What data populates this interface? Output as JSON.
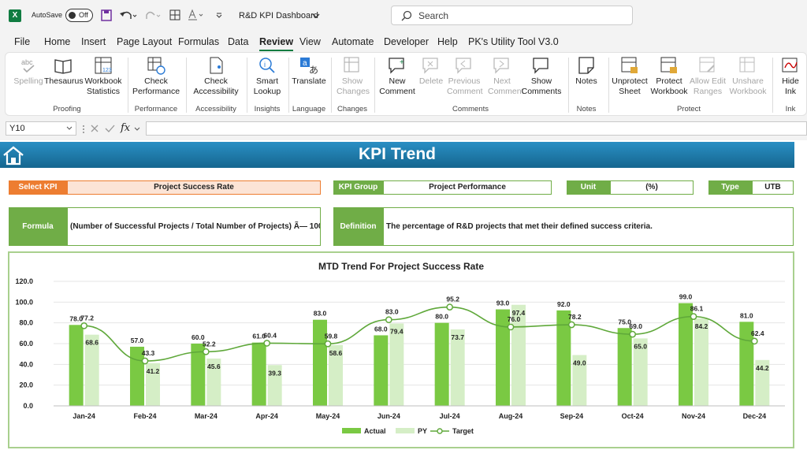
{
  "titlebar": {
    "excel_glyph": "X",
    "autosave_label": "AutoSave",
    "toggle_state": "Off",
    "doc_title": "R&D KPI Dashboard",
    "search_placeholder": "Search"
  },
  "menu": [
    "File",
    "Home",
    "Insert",
    "Page Layout",
    "Formulas",
    "Data",
    "Review",
    "View",
    "Automate",
    "Developer",
    "Help",
    "PK's Utility Tool V3.0"
  ],
  "menu_active": "Review",
  "ribbon": {
    "buttons": [
      {
        "label": "Spelling",
        "icon": "abc-check-icon",
        "enabled": false
      },
      {
        "label": "Thesaurus",
        "icon": "book-icon",
        "enabled": true
      },
      {
        "label": "Workbook Statistics",
        "icon": "statistics-icon",
        "enabled": true
      },
      {
        "label": "Check Performance",
        "icon": "performance-icon",
        "enabled": true
      },
      {
        "label": "Check Accessibility",
        "icon": "accessibility-icon",
        "enabled": true
      },
      {
        "label": "Smart Lookup",
        "icon": "lookup-icon",
        "enabled": true
      },
      {
        "label": "Translate",
        "icon": "translate-icon",
        "enabled": true
      },
      {
        "label": "Show Changes",
        "icon": "show-changes-icon",
        "enabled": false
      },
      {
        "label": "New Comment",
        "icon": "new-comment-icon",
        "enabled": true
      },
      {
        "label": "Delete",
        "icon": "delete-comment-icon",
        "enabled": false
      },
      {
        "label": "Previous Comment",
        "icon": "previous-comment-icon",
        "enabled": false
      },
      {
        "label": "Next Comment",
        "icon": "next-comment-icon",
        "enabled": false
      },
      {
        "label": "Show Comments",
        "icon": "show-comments-icon",
        "enabled": true
      },
      {
        "label": "Notes",
        "icon": "notes-icon",
        "enabled": true
      },
      {
        "label": "Unprotect Sheet",
        "icon": "unprotect-sheet-icon",
        "enabled": true
      },
      {
        "label": "Protect Workbook",
        "icon": "protect-workbook-icon",
        "enabled": true
      },
      {
        "label": "Allow Edit Ranges",
        "icon": "allow-edit-ranges-icon",
        "enabled": false
      },
      {
        "label": "Unshare Workbook",
        "icon": "unshare-workbook-icon",
        "enabled": false
      },
      {
        "label": "Hide Ink",
        "icon": "ink-icon",
        "enabled": true
      }
    ],
    "groups": [
      "Proofing",
      "Performance",
      "Accessibility",
      "Insights",
      "Language",
      "Changes",
      "Comments",
      "Notes",
      "Protect",
      "Ink"
    ]
  },
  "formula_bar": {
    "cell_ref": "Y10",
    "fx": "fx",
    "content": ""
  },
  "dashboard": {
    "title": "KPI Trend",
    "select_kpi_label": "Select KPI",
    "select_kpi_value": "Project Success Rate",
    "kpi_group_label": "KPI Group",
    "kpi_group_value": "Project Performance",
    "unit_label": "Unit",
    "unit_value": "(%)",
    "type_label": "Type",
    "type_value": "UTB",
    "formula_label": "Formula",
    "formula_value": "(Number of Successful Projects / Total Number of Projects) Ã— 100",
    "definition_label": "Definition",
    "definition_value": "The percentage of R&D projects that met their defined success criteria.",
    "colors": {
      "banner": "#1f7fb3",
      "label_green": "#70ad47",
      "select_orange": "#ed7d31",
      "actual": "#7ac943",
      "py": "#d5eec6",
      "target": "#5fa83a"
    }
  },
  "chart_data": {
    "type": "bar",
    "title": "MTD Trend For Project Success Rate",
    "categories": [
      "Jan-24",
      "Feb-24",
      "Mar-24",
      "Apr-24",
      "May-24",
      "Jun-24",
      "Jul-24",
      "Aug-24",
      "Sep-24",
      "Oct-24",
      "Nov-24",
      "Dec-24"
    ],
    "series": [
      {
        "name": "Actual",
        "kind": "bar",
        "values": [
          78.0,
          57.0,
          60.0,
          61.0,
          83.0,
          68.0,
          80.0,
          93.0,
          92.0,
          75.0,
          99.0,
          81.0
        ]
      },
      {
        "name": "PY",
        "kind": "bar",
        "values": [
          68.6,
          41.2,
          45.6,
          39.3,
          58.6,
          79.4,
          73.7,
          97.4,
          49.0,
          65.0,
          84.2,
          44.2
        ]
      },
      {
        "name": "Target",
        "kind": "line",
        "values": [
          77.2,
          43.3,
          52.2,
          60.4,
          59.8,
          83.0,
          95.2,
          76.0,
          78.2,
          69.0,
          86.1,
          62.4
        ]
      }
    ],
    "ylim": [
      0,
      120
    ],
    "yticks": [
      "0.0",
      "20.0",
      "40.0",
      "60.0",
      "80.0",
      "100.0",
      "120.0"
    ],
    "grid": true,
    "legend": "bottom"
  }
}
